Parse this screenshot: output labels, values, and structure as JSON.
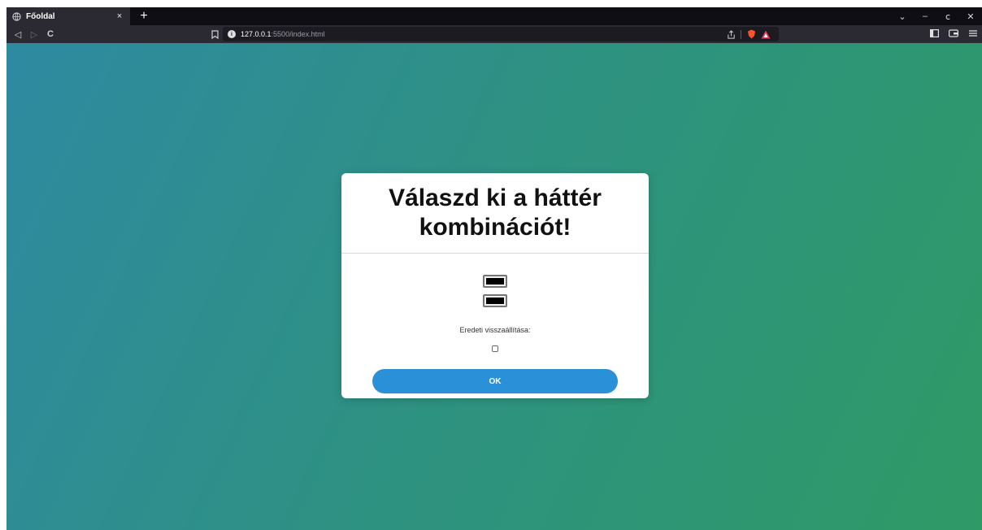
{
  "browser": {
    "tab": {
      "title": "Főoldal",
      "close_glyph": "×",
      "icon": "globe-icon"
    },
    "new_tab_glyph": "+",
    "window_controls": {
      "menu": "⌄",
      "minimize": "–",
      "restore": "ⅽ",
      "close": "✕"
    },
    "nav": {
      "back": "◁",
      "forward": "▷",
      "reload": "C"
    },
    "url": {
      "host": "127.0.0.1",
      "rest": ":5500/index.html"
    }
  },
  "dialog": {
    "title": "Válaszd ki a háttér kombinációt!",
    "color1": "#000000",
    "color2": "#000000",
    "reset_label": "Eredeti visszaállítása:",
    "reset_checked": false,
    "ok_label": "OK"
  },
  "colors": {
    "gradient_start": "#2e8aa1",
    "gradient_end": "#2f9a66",
    "button": "#2a90d8"
  }
}
